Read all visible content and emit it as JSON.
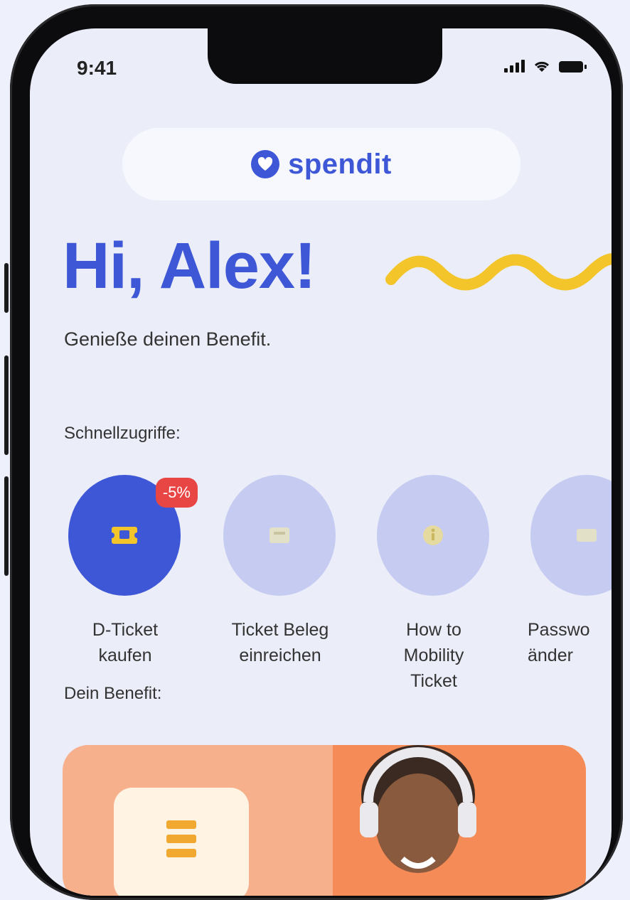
{
  "status_bar": {
    "time": "9:41"
  },
  "brand": {
    "name": "spendit",
    "logo_icon": "heart-badge-icon"
  },
  "hero": {
    "greeting": "Hi, Alex!",
    "subtitle": "Genieße deinen Benefit."
  },
  "quick_access": {
    "label": "Schnellzugriffe:",
    "items": [
      {
        "label_line1": "D-Ticket",
        "label_line2": "kaufen",
        "label_line3": "",
        "badge": "-5%",
        "icon": "ticket-icon",
        "active": true
      },
      {
        "label_line1": "Ticket Beleg",
        "label_line2": "einreichen",
        "label_line3": "",
        "icon": "receipt-icon",
        "active": false
      },
      {
        "label_line1": "How to",
        "label_line2": "Mobility",
        "label_line3": "Ticket",
        "icon": "info-icon",
        "active": false
      },
      {
        "label_line1": "Passwo",
        "label_line2": "änder",
        "label_line3": "",
        "icon": "password-icon",
        "active": false
      }
    ]
  },
  "benefit": {
    "label": "Dein Benefit:"
  },
  "colors": {
    "primary": "#3e57d6",
    "accent_yellow": "#f3c52a",
    "badge_red": "#e84545",
    "blob_inactive": "#c6cbf1",
    "card_orange": "#f58b56"
  }
}
